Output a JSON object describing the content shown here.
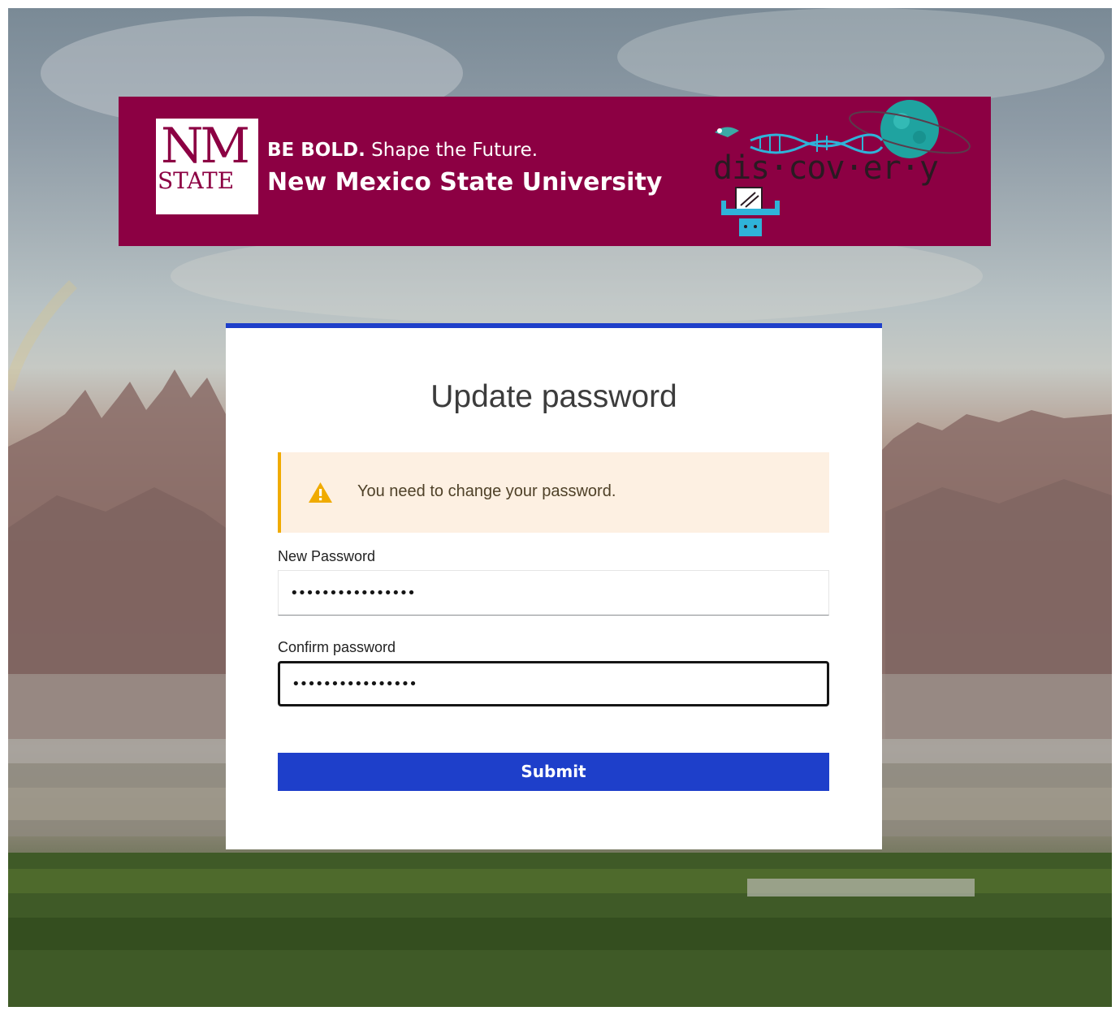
{
  "banner": {
    "logo_nm": "NM",
    "logo_state": "STATE",
    "tagline_bold": "BE BOLD.",
    "tagline_rest": " Shape the Future.",
    "university": "New Mexico State University",
    "discovery": "dis·cov·er·y"
  },
  "form": {
    "title": "Update password",
    "alert_text": "You need to change your password.",
    "new_password_label": "New Password",
    "new_password_value": "••••••••••••••••",
    "confirm_password_label": "Confirm password",
    "confirm_password_value": "••••••••••••••••",
    "submit_label": "Submit"
  },
  "colors": {
    "brand_crimson": "#8c0043",
    "primary_blue": "#1e3fca",
    "warning_amber": "#f0ab00",
    "alert_bg": "#fdf0e2"
  },
  "icons": {
    "alert": "warning-triangle-icon"
  }
}
